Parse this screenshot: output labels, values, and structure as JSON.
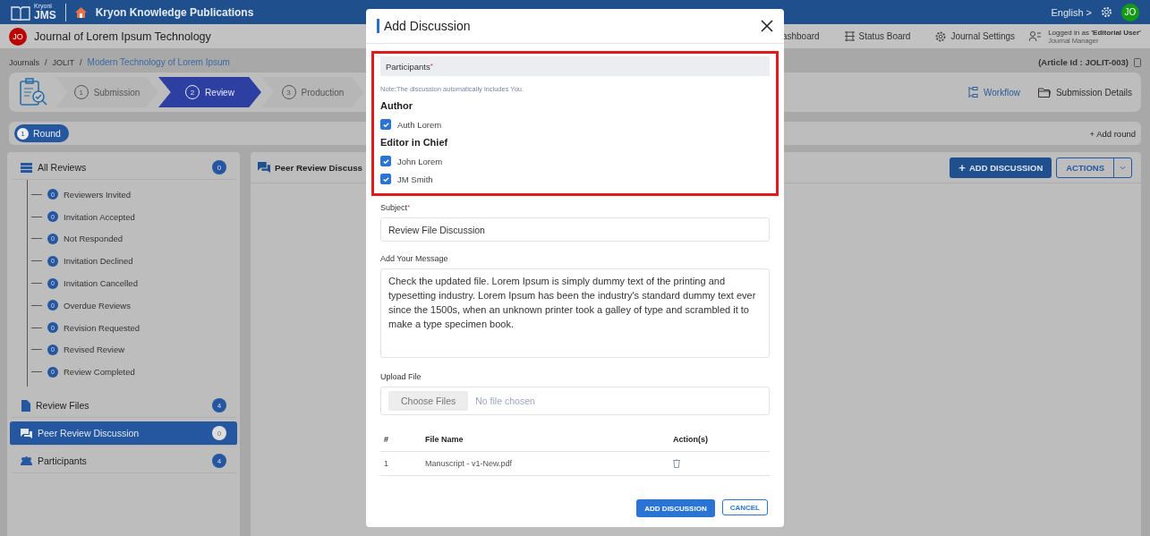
{
  "top_bar": {
    "logo_small": "Kryoni",
    "logo_big": "JMS",
    "publisher": "Kryon Knowledge Publications",
    "language": "English",
    "language_caret": ">",
    "avatar": "JO"
  },
  "journal_bar": {
    "badge": "JO",
    "title": "Journal of Lorem Ipsum Technology",
    "nav": [
      "ashboard",
      "Status Board",
      "Journal Settings"
    ],
    "logged_in_prefix": "Logged in as ",
    "logged_in_user": "'Editorial User'",
    "role": "Journal Manager"
  },
  "breadcrumbs": [
    "Journals",
    "JOLIT",
    "Modern Technology of Lorem Ipsum"
  ],
  "breadcrumb_separator": "/",
  "article_id": "(Article Id : JOLIT-003)",
  "steps": [
    {
      "number": "1",
      "label": "Submission",
      "selected": false
    },
    {
      "number": "2",
      "label": "Review",
      "selected": true
    },
    {
      "number": "3",
      "label": "Production",
      "selected": false
    }
  ],
  "step_links": [
    "Workflow",
    "Submission Details"
  ],
  "round": {
    "number": "1",
    "label": "Round",
    "add": "+ Add round"
  },
  "sidebar": {
    "all_reviews": {
      "label": "All Reviews",
      "count": "0"
    },
    "review_states": [
      {
        "label": "Reviewers Invited",
        "count": "0"
      },
      {
        "label": "Invitation Accepted",
        "count": "0"
      },
      {
        "label": "Not Responded",
        "count": "0"
      },
      {
        "label": "Invitation Declined",
        "count": "0"
      },
      {
        "label": "Invitation Cancelled",
        "count": "0"
      },
      {
        "label": "Overdue Reviews",
        "count": "0"
      },
      {
        "label": "Revision Requested",
        "count": "0"
      },
      {
        "label": "Revised Review",
        "count": "0"
      },
      {
        "label": "Review Completed",
        "count": "0"
      }
    ],
    "items": [
      {
        "kind": "files",
        "label": "Review Files",
        "count": "4",
        "selected": false
      },
      {
        "kind": "discussion",
        "label": "Peer Review Discussion",
        "count": "0",
        "selected": true
      },
      {
        "kind": "participants",
        "label": "Participants",
        "count": "4",
        "selected": false
      }
    ]
  },
  "main": {
    "title": "Peer Review Discuss",
    "add_icon": "+",
    "add_button": "ADD DISCUSSION",
    "actions_button": "ACTIONS"
  },
  "modal": {
    "title": "Add Discussion",
    "participants_label": "Participants",
    "required_mark": "*",
    "note": "Note:The discussion automatically includes You.",
    "groups": [
      {
        "title": "Author",
        "members": [
          {
            "name": "Auth Lorem",
            "checked": true
          }
        ]
      },
      {
        "title": "Editor in Chief",
        "members": [
          {
            "name": "John Lorem",
            "checked": true
          },
          {
            "name": "JM Smith",
            "checked": true
          }
        ]
      }
    ],
    "subject_label": "Subject",
    "subject_value": "Review File Discussion",
    "message_label": "Add Your Message",
    "message_value": "Check the updated file. Lorem Ipsum is simply dummy text of the printing and typesetting industry. Lorem Ipsum has been the industry's standard dummy text ever since the 1500s, when an unknown printer took a galley of type and scrambled it to make a type specimen book.",
    "upload_label": "Upload File",
    "choose_button": "Choose Files",
    "no_file": "No file chosen",
    "table": {
      "columns": [
        "#",
        "File Name",
        "Action(s)"
      ],
      "rows": [
        {
          "number": "1",
          "file_name": "Manuscript - v1-New.pdf"
        }
      ]
    },
    "submit_button": "ADD DISCUSSION",
    "cancel_button": "CANCEL"
  }
}
